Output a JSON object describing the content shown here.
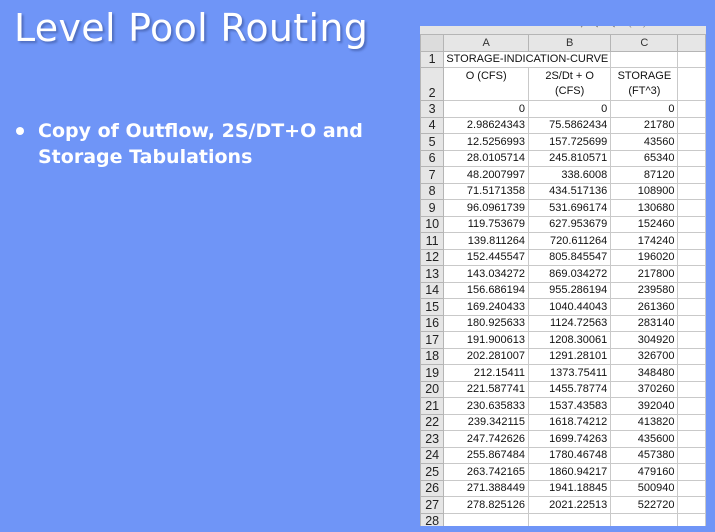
{
  "slide": {
    "title": "Level Pool Routing",
    "bullet": "Copy of Outflow, 2S/DT+O and Storage Tabulations"
  },
  "spreadsheet": {
    "columns": [
      "A",
      "B",
      "C"
    ],
    "title_cell": "STORAGE-INDICATION-CURVE",
    "headers": {
      "a": "O (CFS)",
      "b_line1": "2S/Dt + O",
      "b_line2": "(CFS)",
      "c_line1": "STORAGE",
      "c_line2": "(FT^3)"
    },
    "rows": [
      {
        "n": "3",
        "a": "0",
        "b": "0",
        "c": "0"
      },
      {
        "n": "4",
        "a": "2.98624343",
        "b": "75.5862434",
        "c": "21780"
      },
      {
        "n": "5",
        "a": "12.5256993",
        "b": "157.725699",
        "c": "43560"
      },
      {
        "n": "6",
        "a": "28.0105714",
        "b": "245.810571",
        "c": "65340"
      },
      {
        "n": "7",
        "a": "48.2007997",
        "b": "338.6008",
        "c": "87120"
      },
      {
        "n": "8",
        "a": "71.5171358",
        "b": "434.517136",
        "c": "108900"
      },
      {
        "n": "9",
        "a": "96.0961739",
        "b": "531.696174",
        "c": "130680"
      },
      {
        "n": "10",
        "a": "119.753679",
        "b": "627.953679",
        "c": "152460"
      },
      {
        "n": "11",
        "a": "139.811264",
        "b": "720.611264",
        "c": "174240"
      },
      {
        "n": "12",
        "a": "152.445547",
        "b": "805.845547",
        "c": "196020"
      },
      {
        "n": "13",
        "a": "143.034272",
        "b": "869.034272",
        "c": "217800"
      },
      {
        "n": "14",
        "a": "156.686194",
        "b": "955.286194",
        "c": "239580"
      },
      {
        "n": "15",
        "a": "169.240433",
        "b": "1040.44043",
        "c": "261360"
      },
      {
        "n": "16",
        "a": "180.925633",
        "b": "1124.72563",
        "c": "283140"
      },
      {
        "n": "17",
        "a": "191.900613",
        "b": "1208.30061",
        "c": "304920"
      },
      {
        "n": "18",
        "a": "202.281007",
        "b": "1291.28101",
        "c": "326700"
      },
      {
        "n": "19",
        "a": "212.15411",
        "b": "1373.75411",
        "c": "348480"
      },
      {
        "n": "20",
        "a": "221.587741",
        "b": "1455.78774",
        "c": "370260"
      },
      {
        "n": "21",
        "a": "230.635833",
        "b": "1537.43583",
        "c": "392040"
      },
      {
        "n": "22",
        "a": "239.342115",
        "b": "1618.74212",
        "c": "413820"
      },
      {
        "n": "23",
        "a": "247.742626",
        "b": "1699.74263",
        "c": "435600"
      },
      {
        "n": "24",
        "a": "255.867484",
        "b": "1780.46748",
        "c": "457380"
      },
      {
        "n": "25",
        "a": "263.742165",
        "b": "1860.94217",
        "c": "479160"
      },
      {
        "n": "26",
        "a": "271.388449",
        "b": "1941.18845",
        "c": "500940"
      },
      {
        "n": "27",
        "a": "278.825126",
        "b": "2021.22513",
        "c": "522720"
      },
      {
        "n": "28",
        "a": "",
        "b": "",
        "c": ""
      }
    ]
  },
  "colors": {
    "background": "#6f95f7",
    "title_text": "#ffffff",
    "sheet_header": "#e6e6e6"
  }
}
